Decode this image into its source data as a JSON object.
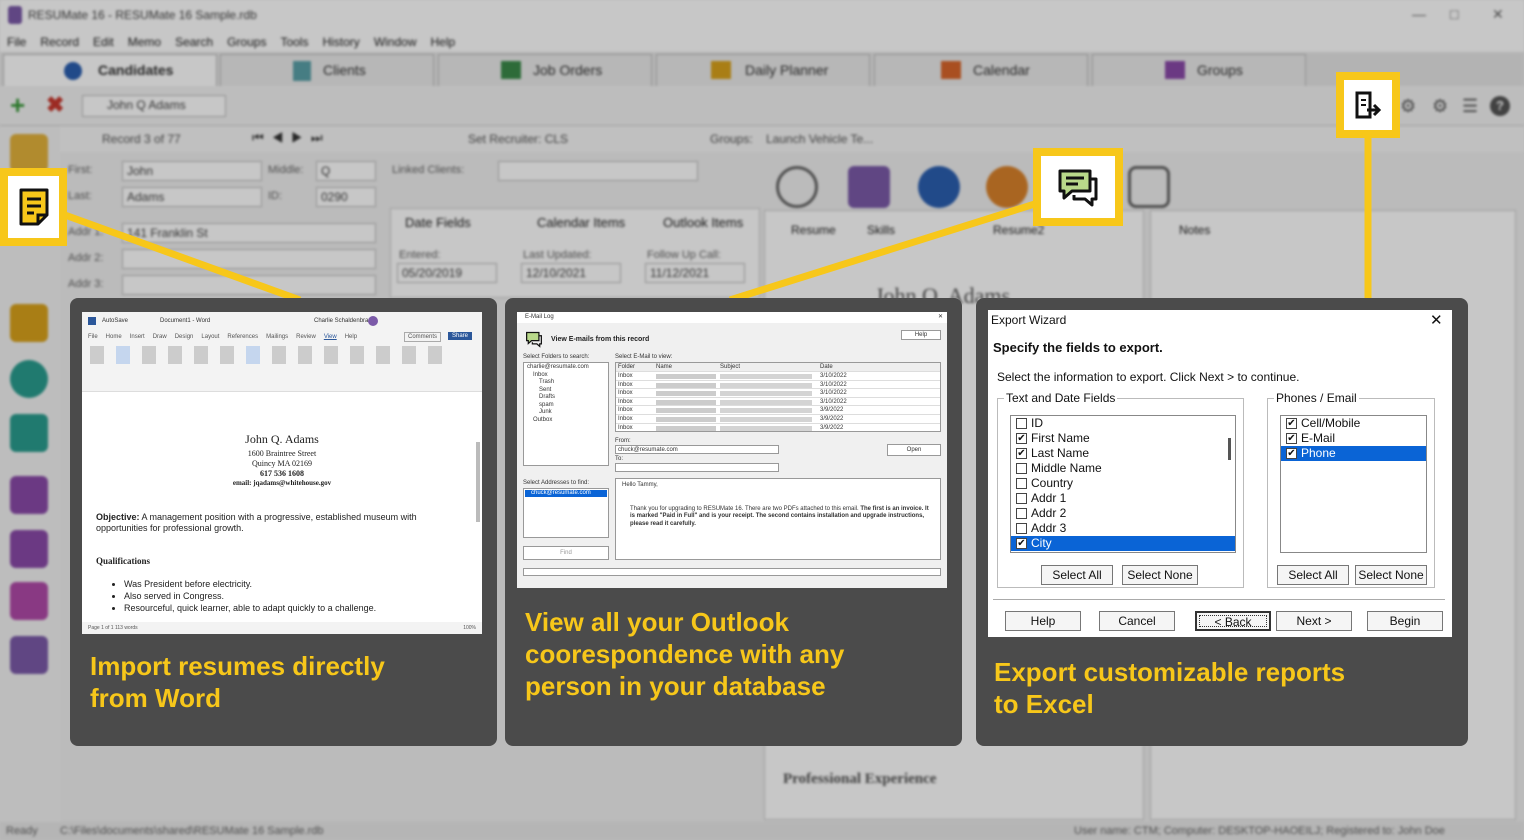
{
  "app": {
    "title": "RESUMate 16 - RESUMate 16 Sample.rdb",
    "menu": [
      "File",
      "Record",
      "Edit",
      "Memo",
      "Search",
      "Groups",
      "Tools",
      "History",
      "Window",
      "Help"
    ],
    "tabs": [
      "Candidates",
      "Clients",
      "Job Orders",
      "Daily Planner",
      "Calendar",
      "Groups"
    ],
    "current_record": "John Q Adams",
    "record_counter": "Record 3 of 77",
    "set_recruiter": "Set Recruiter: CLS",
    "groups_label": "Groups:",
    "groups_value": "Launch Vehicle Te...",
    "fields": {
      "first_label": "First:",
      "first": "John",
      "middle_label": "Middle:",
      "middle": "Q",
      "last_label": "Last:",
      "last": "Adams",
      "id_label": "ID:",
      "id": "0290",
      "addr1_label": "Addr 1:",
      "addr1": "141 Franklin St",
      "addr2_label": "Addr 2:",
      "addr3_label": "Addr 3:"
    },
    "linked_clients_label": "Linked Clients:",
    "subtabs": [
      "Date Fields",
      "Calendar Items",
      "Outlook Items"
    ],
    "dates": {
      "entered_label": "Entered:",
      "entered": "05/20/2019",
      "updated_label": "Last Updated:",
      "updated": "12/10/2021",
      "followup_label": "Follow Up Call:",
      "followup": "11/12/2021"
    },
    "doc_tabs": [
      "Resume",
      "Skills",
      "Resume2"
    ],
    "notes_tab": "Notes",
    "resume_name": "John Q. Adams",
    "resume_section": "Professional Experience",
    "status": {
      "left": "Ready",
      "path": "C:\\Files\\documents\\shared\\RESUMate 16 Sample.rdb",
      "right": "User name: CTM; Computer: DESKTOP-HAOEILJ; Registered to: John Doe"
    }
  },
  "features": [
    {
      "caption_line1": "Import resumes directly",
      "caption_line2": "from Word",
      "icon": "note-icon"
    },
    {
      "caption_line1": "View all your Outlook",
      "caption_line2": "coorespondence with any",
      "caption_line3": "person in your database",
      "icon": "chat-icon"
    },
    {
      "caption_line1": "Export customizable reports",
      "caption_line2": "to Excel",
      "icon": "export-icon"
    }
  ],
  "word": {
    "title": "Document1 - Word",
    "user": "Charlie Schaldenbrand",
    "autosave": "AutoSave",
    "ribbon_tabs": [
      "File",
      "Home",
      "Insert",
      "Draw",
      "Design",
      "Layout",
      "References",
      "Mailings",
      "Review",
      "View",
      "Help"
    ],
    "comments": "Comments",
    "share": "Share",
    "name": "John Q. Adams",
    "addr1": "1600 Braintree Street",
    "addr2": "Quincy MA 02169",
    "phone": "617 536 1608",
    "email": "email: jqadams@whitehouse.gov",
    "objective_label": "Objective:",
    "objective": "A management position with a progressive, established museum with opportunities for professional growth.",
    "qual_title": "Qualifications",
    "quals": [
      "Was President before electricity.",
      "Also served in Congress.",
      "Resourceful, quick learner, able to adapt quickly to a challenge."
    ],
    "statusbar": "Page 1 of 1    113 words",
    "zoom": "100%"
  },
  "email_log": {
    "title": "E-Mail Log",
    "heading": "View E-mails from this record",
    "help": "Help",
    "folders_label": "Select Folders to search:",
    "account": "charlie@resumate.com",
    "folders": [
      "Inbox",
      "Trash",
      "Sent",
      "Drafts",
      "spam",
      "Junk",
      "Outbox"
    ],
    "select_email_label": "Select E-Mail to view:",
    "columns": [
      "Folder",
      "Name",
      "Subject",
      "Date"
    ],
    "rows": [
      {
        "folder": "Inbox",
        "date": "3/10/2022"
      },
      {
        "folder": "Inbox",
        "date": "3/10/2022"
      },
      {
        "folder": "Inbox",
        "date": "3/10/2022"
      },
      {
        "folder": "Inbox",
        "date": "3/10/2022"
      },
      {
        "folder": "Inbox",
        "date": "3/9/2022"
      },
      {
        "folder": "Inbox",
        "date": "3/9/2022"
      },
      {
        "folder": "Inbox",
        "date": "3/9/2022"
      }
    ],
    "from_label": "From:",
    "from": "chuck@resumate.com",
    "to_label": "To:",
    "open": "Open",
    "addresses_label": "Select Addresses to find:",
    "address": "chuck@resumate.com",
    "find": "Find",
    "body_greeting": "Hello Tammy,",
    "body_text": "Thank you for upgrading to RESUMate 16. There are two PDFs attached to this email.",
    "body_bold": "The first is an invoice. It is marked \"Paid in Full\" and is your receipt. The second contains installation and upgrade instructions, please read it carefully."
  },
  "export_wizard": {
    "title": "Export Wizard",
    "heading": "Specify the fields to export.",
    "instruction": "Select the information to export. Click Next > to continue.",
    "group_text": "Text and Date Fields",
    "group_phones": "Phones / Email",
    "text_fields": [
      {
        "label": "ID",
        "checked": false,
        "selected": false
      },
      {
        "label": "First Name",
        "checked": true,
        "selected": false
      },
      {
        "label": "Last Name",
        "checked": true,
        "selected": false
      },
      {
        "label": "Middle Name",
        "checked": false,
        "selected": false
      },
      {
        "label": "Country",
        "checked": false,
        "selected": false
      },
      {
        "label": "Addr 1",
        "checked": false,
        "selected": false
      },
      {
        "label": "Addr 2",
        "checked": false,
        "selected": false
      },
      {
        "label": "Addr 3",
        "checked": false,
        "selected": false
      },
      {
        "label": "City",
        "checked": true,
        "selected": true
      }
    ],
    "phone_fields": [
      {
        "label": "Cell/Mobile",
        "checked": true,
        "selected": false
      },
      {
        "label": "E-Mail",
        "checked": true,
        "selected": false
      },
      {
        "label": "Phone",
        "checked": true,
        "selected": true
      }
    ],
    "select_all": "Select All",
    "select_none": "Select None",
    "help": "Help",
    "cancel": "Cancel",
    "back": "< Back",
    "next": "Next >",
    "begin": "Begin"
  },
  "colors": {
    "accent": "#f7c71a",
    "card": "#4b4b4b",
    "selection": "#0a64d6"
  }
}
